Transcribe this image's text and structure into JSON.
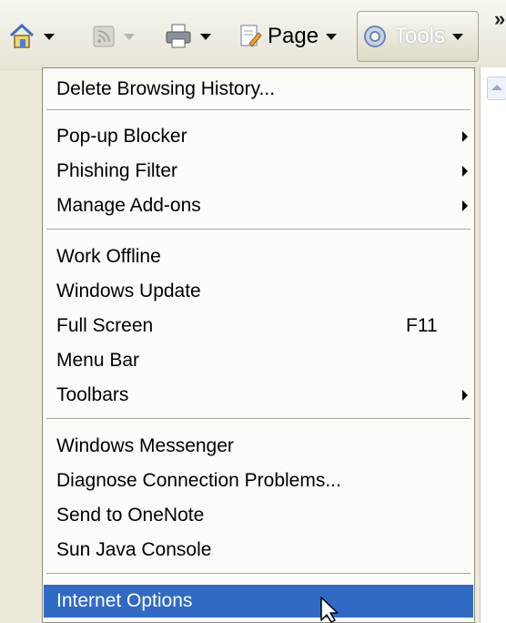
{
  "toolbar": {
    "home_icon": "home-icon",
    "feeds_icon": "feeds-icon",
    "print_icon": "print-icon",
    "page_icon": "page-icon",
    "page_label": "Page",
    "tools_icon": "gear-icon",
    "tools_label": "Tools",
    "more_label": "»"
  },
  "menu": {
    "items": [
      {
        "label": "Delete Browsing History...",
        "shortcut": "",
        "submenu": false
      },
      {
        "label": "Pop-up Blocker",
        "shortcut": "",
        "submenu": true
      },
      {
        "label": "Phishing Filter",
        "shortcut": "",
        "submenu": true
      },
      {
        "label": "Manage Add-ons",
        "shortcut": "",
        "submenu": true
      },
      {
        "label": "Work Offline",
        "shortcut": "",
        "submenu": false
      },
      {
        "label": "Windows Update",
        "shortcut": "",
        "submenu": false
      },
      {
        "label": "Full Screen",
        "shortcut": "F11",
        "submenu": false
      },
      {
        "label": "Menu Bar",
        "shortcut": "",
        "submenu": false
      },
      {
        "label": "Toolbars",
        "shortcut": "",
        "submenu": true
      },
      {
        "label": "Windows Messenger",
        "shortcut": "",
        "submenu": false
      },
      {
        "label": "Diagnose Connection Problems...",
        "shortcut": "",
        "submenu": false
      },
      {
        "label": "Send to OneNote",
        "shortcut": "",
        "submenu": false
      },
      {
        "label": "Sun Java Console",
        "shortcut": "",
        "submenu": false
      },
      {
        "label": "Internet Options",
        "shortcut": "",
        "submenu": false,
        "selected": true
      }
    ]
  },
  "colors": {
    "selection": "#316ac5",
    "toolbar_bg": "#ece9d8"
  }
}
